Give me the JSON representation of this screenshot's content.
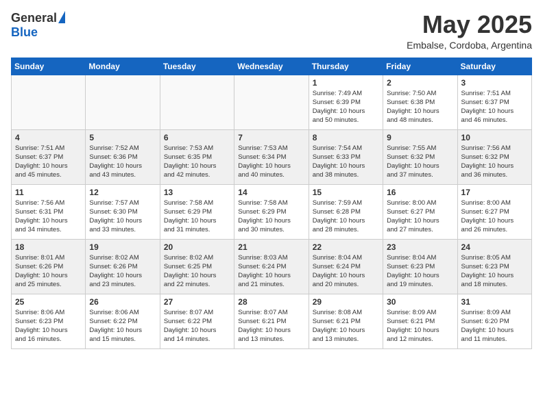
{
  "header": {
    "logo_general": "General",
    "logo_blue": "Blue",
    "month_title": "May 2025",
    "subtitle": "Embalse, Cordoba, Argentina"
  },
  "weekdays": [
    "Sunday",
    "Monday",
    "Tuesday",
    "Wednesday",
    "Thursday",
    "Friday",
    "Saturday"
  ],
  "weeks": [
    [
      {
        "day": "",
        "info": ""
      },
      {
        "day": "",
        "info": ""
      },
      {
        "day": "",
        "info": ""
      },
      {
        "day": "",
        "info": ""
      },
      {
        "day": "1",
        "info": "Sunrise: 7:49 AM\nSunset: 6:39 PM\nDaylight: 10 hours\nand 50 minutes."
      },
      {
        "day": "2",
        "info": "Sunrise: 7:50 AM\nSunset: 6:38 PM\nDaylight: 10 hours\nand 48 minutes."
      },
      {
        "day": "3",
        "info": "Sunrise: 7:51 AM\nSunset: 6:37 PM\nDaylight: 10 hours\nand 46 minutes."
      }
    ],
    [
      {
        "day": "4",
        "info": "Sunrise: 7:51 AM\nSunset: 6:37 PM\nDaylight: 10 hours\nand 45 minutes."
      },
      {
        "day": "5",
        "info": "Sunrise: 7:52 AM\nSunset: 6:36 PM\nDaylight: 10 hours\nand 43 minutes."
      },
      {
        "day": "6",
        "info": "Sunrise: 7:53 AM\nSunset: 6:35 PM\nDaylight: 10 hours\nand 42 minutes."
      },
      {
        "day": "7",
        "info": "Sunrise: 7:53 AM\nSunset: 6:34 PM\nDaylight: 10 hours\nand 40 minutes."
      },
      {
        "day": "8",
        "info": "Sunrise: 7:54 AM\nSunset: 6:33 PM\nDaylight: 10 hours\nand 38 minutes."
      },
      {
        "day": "9",
        "info": "Sunrise: 7:55 AM\nSunset: 6:32 PM\nDaylight: 10 hours\nand 37 minutes."
      },
      {
        "day": "10",
        "info": "Sunrise: 7:56 AM\nSunset: 6:32 PM\nDaylight: 10 hours\nand 36 minutes."
      }
    ],
    [
      {
        "day": "11",
        "info": "Sunrise: 7:56 AM\nSunset: 6:31 PM\nDaylight: 10 hours\nand 34 minutes."
      },
      {
        "day": "12",
        "info": "Sunrise: 7:57 AM\nSunset: 6:30 PM\nDaylight: 10 hours\nand 33 minutes."
      },
      {
        "day": "13",
        "info": "Sunrise: 7:58 AM\nSunset: 6:29 PM\nDaylight: 10 hours\nand 31 minutes."
      },
      {
        "day": "14",
        "info": "Sunrise: 7:58 AM\nSunset: 6:29 PM\nDaylight: 10 hours\nand 30 minutes."
      },
      {
        "day": "15",
        "info": "Sunrise: 7:59 AM\nSunset: 6:28 PM\nDaylight: 10 hours\nand 28 minutes."
      },
      {
        "day": "16",
        "info": "Sunrise: 8:00 AM\nSunset: 6:27 PM\nDaylight: 10 hours\nand 27 minutes."
      },
      {
        "day": "17",
        "info": "Sunrise: 8:00 AM\nSunset: 6:27 PM\nDaylight: 10 hours\nand 26 minutes."
      }
    ],
    [
      {
        "day": "18",
        "info": "Sunrise: 8:01 AM\nSunset: 6:26 PM\nDaylight: 10 hours\nand 25 minutes."
      },
      {
        "day": "19",
        "info": "Sunrise: 8:02 AM\nSunset: 6:26 PM\nDaylight: 10 hours\nand 23 minutes."
      },
      {
        "day": "20",
        "info": "Sunrise: 8:02 AM\nSunset: 6:25 PM\nDaylight: 10 hours\nand 22 minutes."
      },
      {
        "day": "21",
        "info": "Sunrise: 8:03 AM\nSunset: 6:24 PM\nDaylight: 10 hours\nand 21 minutes."
      },
      {
        "day": "22",
        "info": "Sunrise: 8:04 AM\nSunset: 6:24 PM\nDaylight: 10 hours\nand 20 minutes."
      },
      {
        "day": "23",
        "info": "Sunrise: 8:04 AM\nSunset: 6:23 PM\nDaylight: 10 hours\nand 19 minutes."
      },
      {
        "day": "24",
        "info": "Sunrise: 8:05 AM\nSunset: 6:23 PM\nDaylight: 10 hours\nand 18 minutes."
      }
    ],
    [
      {
        "day": "25",
        "info": "Sunrise: 8:06 AM\nSunset: 6:23 PM\nDaylight: 10 hours\nand 16 minutes."
      },
      {
        "day": "26",
        "info": "Sunrise: 8:06 AM\nSunset: 6:22 PM\nDaylight: 10 hours\nand 15 minutes."
      },
      {
        "day": "27",
        "info": "Sunrise: 8:07 AM\nSunset: 6:22 PM\nDaylight: 10 hours\nand 14 minutes."
      },
      {
        "day": "28",
        "info": "Sunrise: 8:07 AM\nSunset: 6:21 PM\nDaylight: 10 hours\nand 13 minutes."
      },
      {
        "day": "29",
        "info": "Sunrise: 8:08 AM\nSunset: 6:21 PM\nDaylight: 10 hours\nand 13 minutes."
      },
      {
        "day": "30",
        "info": "Sunrise: 8:09 AM\nSunset: 6:21 PM\nDaylight: 10 hours\nand 12 minutes."
      },
      {
        "day": "31",
        "info": "Sunrise: 8:09 AM\nSunset: 6:20 PM\nDaylight: 10 hours\nand 11 minutes."
      }
    ]
  ]
}
